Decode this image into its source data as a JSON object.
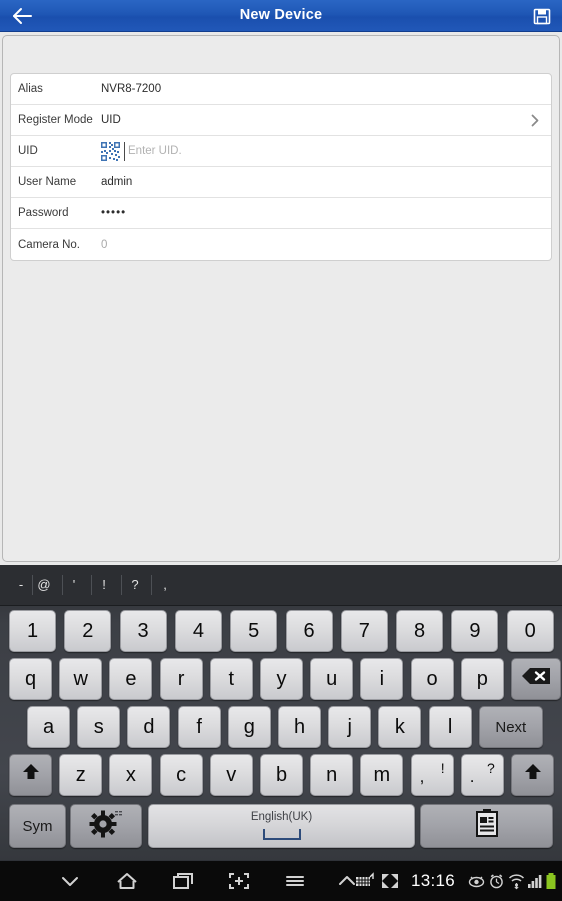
{
  "titlebar": {
    "title": "New Device",
    "back_icon": "back-arrow-icon",
    "save_icon": "save-floppy-icon"
  },
  "form": {
    "rows": [
      {
        "label": "Alias",
        "value": "NVR8-7200",
        "type": "text"
      },
      {
        "label": "Register Mode",
        "value": "UID",
        "type": "select"
      },
      {
        "label": "UID",
        "value": "",
        "placeholder": "Enter UID.",
        "type": "uid"
      },
      {
        "label": "User Name",
        "value": "admin",
        "type": "text"
      },
      {
        "label": "Password",
        "value": "•••••",
        "type": "password"
      },
      {
        "label": "Camera No.",
        "value": "0",
        "type": "readonly"
      }
    ]
  },
  "keyboard": {
    "suggestions": [
      "-",
      "@",
      "'",
      "!",
      "?",
      ","
    ],
    "row_numbers": [
      "1",
      "2",
      "3",
      "4",
      "5",
      "6",
      "7",
      "8",
      "9",
      "0"
    ],
    "row_top": [
      "q",
      "w",
      "e",
      "r",
      "t",
      "y",
      "u",
      "i",
      "o",
      "p"
    ],
    "backspace_label": "backspace-icon",
    "row_home": [
      "a",
      "s",
      "d",
      "f",
      "g",
      "h",
      "j",
      "k",
      "l"
    ],
    "next_label": "Next",
    "row_bottom": [
      "z",
      "x",
      "c",
      "v",
      "b",
      "n",
      "m"
    ],
    "combo_comma": {
      "primary": ",",
      "secondary": "!"
    },
    "combo_period": {
      "primary": ".",
      "secondary": "?"
    },
    "shift_label": "shift-icon",
    "sym_label": "Sym",
    "settings_label": "gear-icon",
    "space_language": "English(UK)",
    "clipboard_label": "clipboard-icon"
  },
  "navbar": {
    "hide_keyboard_icon": "chevron-down-icon",
    "home_icon": "home-icon",
    "recents_icon": "recent-apps-icon",
    "screenshot_icon": "screen-capture-icon",
    "menu_icon": "menu-icon",
    "up_icon": "chevron-up-icon",
    "keyboard_status_icon": "keyboard-icon",
    "expand_icon": "expand-arrows-icon",
    "time": "13:16",
    "eye_icon": "smart-stay-eye-icon",
    "alarm_icon": "alarm-clock-icon",
    "wifi_icon": "wifi-icon",
    "signal_icon": "cellular-signal-icon",
    "battery_icon": "battery-icon"
  },
  "colors": {
    "titlebar_blue": "#1f57b5",
    "battery_green": "#8bc520",
    "qr_blue": "#3f74b4",
    "panel_white": "#ffffff",
    "content_gray": "#e9e9e9"
  }
}
